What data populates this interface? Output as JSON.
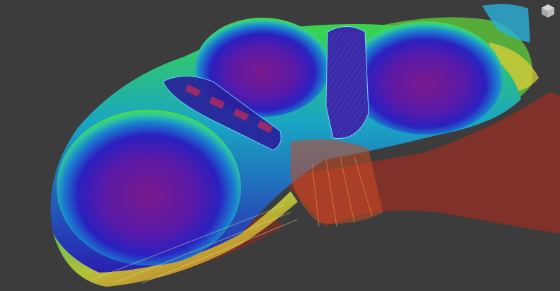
{
  "viewport": {
    "background": "#3c3c3c",
    "view_mode": "point-cloud",
    "color_scale": [
      "#ff2a1a",
      "#f5e83a",
      "#3fe03c",
      "#27b0d8",
      "#2a1fb8",
      "#7a1a8c"
    ],
    "icons": {
      "nav_cube": "view-cube-icon"
    }
  }
}
